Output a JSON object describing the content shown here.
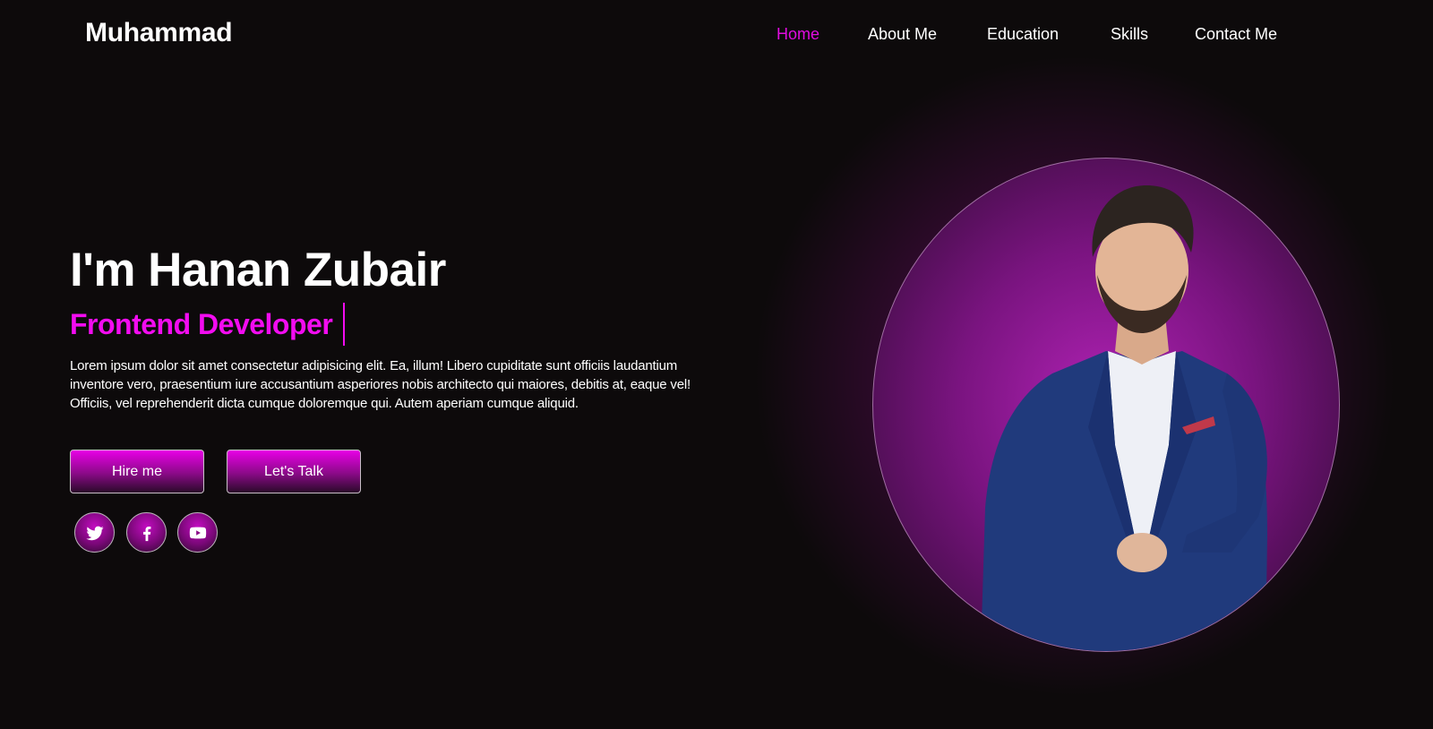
{
  "header": {
    "brand": "Muhammad",
    "nav": [
      {
        "label": "Home",
        "active": true
      },
      {
        "label": "About Me",
        "active": false
      },
      {
        "label": "Education",
        "active": false
      },
      {
        "label": "Skills",
        "active": false
      },
      {
        "label": "Contact Me",
        "active": false
      }
    ]
  },
  "hero": {
    "title": "I'm Hanan Zubair",
    "role": "Frontend Developer",
    "description": "Lorem ipsum dolor sit amet consectetur adipisicing elit. Ea, illum! Libero cupiditate sunt officiis laudantium inventore vero, praesentium iure accusantium asperiores nobis architecto qui maiores, debitis at, eaque vel! Officiis, vel reprehenderit dicta cumque doloremque qui. Autem aperiam cumque aliquid.",
    "buttons": {
      "hire": "Hire me",
      "talk": "Let's Talk"
    },
    "social": [
      {
        "icon": "twitter-icon"
      },
      {
        "icon": "facebook-icon"
      },
      {
        "icon": "youtube-icon"
      }
    ]
  },
  "colors": {
    "background": "#0d0a0b",
    "accent": "#f20cf0",
    "nav_active": "#e10ce0",
    "text": "#ffffff"
  },
  "portrait": {
    "subject": "person in navy blue suit with white shirt"
  }
}
